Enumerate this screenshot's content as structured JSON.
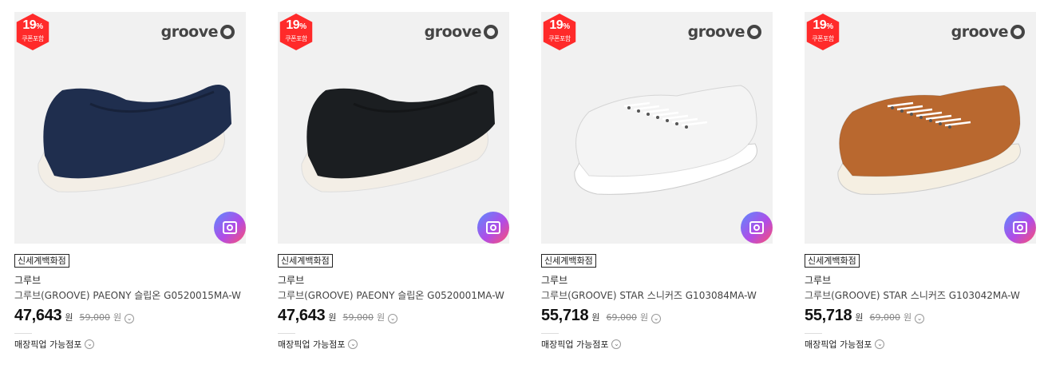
{
  "products": [
    {
      "badge_pct": "19",
      "badge_unit": "%",
      "badge_sub": "쿠폰포함",
      "logo_word": "groove",
      "store": "신세계백화점",
      "brand": "그루브",
      "name": "그루브(GROOVE) PAEONY 슬립온 G0520015MA-W",
      "price": "47,643",
      "price_unit": "원",
      "original_price": "59,000",
      "original_unit": "원",
      "pickup": "매장픽업 가능점포",
      "shoe": {
        "type": "slipon",
        "upper": "#1f2e4e",
        "sole": "#f3eee6"
      }
    },
    {
      "badge_pct": "19",
      "badge_unit": "%",
      "badge_sub": "쿠폰포함",
      "logo_word": "groove",
      "store": "신세계백화점",
      "brand": "그루브",
      "name": "그루브(GROOVE) PAEONY 슬립온 G0520001MA-W",
      "price": "47,643",
      "price_unit": "원",
      "original_price": "59,000",
      "original_unit": "원",
      "pickup": "매장픽업 가능점포",
      "shoe": {
        "type": "slipon",
        "upper": "#1b1e21",
        "sole": "#f3eee6"
      }
    },
    {
      "badge_pct": "19",
      "badge_unit": "%",
      "badge_sub": "쿠폰포함",
      "logo_word": "groove",
      "store": "신세계백화점",
      "brand": "그루브",
      "name": "그루브(GROOVE) STAR 스니커즈 G103084MA-W",
      "price": "55,718",
      "price_unit": "원",
      "original_price": "69,000",
      "original_unit": "원",
      "pickup": "매장픽업 가능점포",
      "shoe": {
        "type": "sneaker",
        "upper": "#f4f4f4",
        "sole": "#ffffff"
      }
    },
    {
      "badge_pct": "19",
      "badge_unit": "%",
      "badge_sub": "쿠폰포함",
      "logo_word": "groove",
      "store": "신세계백화점",
      "brand": "그루브",
      "name": "그루브(GROOVE) STAR 스니커즈 G103042MA-W",
      "price": "55,718",
      "price_unit": "원",
      "original_price": "69,000",
      "original_unit": "원",
      "pickup": "매장픽업 가능점포",
      "shoe": {
        "type": "sneaker",
        "upper": "#b9682f",
        "sole": "#f5efe2"
      }
    }
  ],
  "icons": {
    "discount_badge": "hexagon-badge-icon",
    "brand_logo": "groove-logo-icon",
    "review": "camera-review-icon",
    "info": "chevron-down-circle-icon"
  }
}
